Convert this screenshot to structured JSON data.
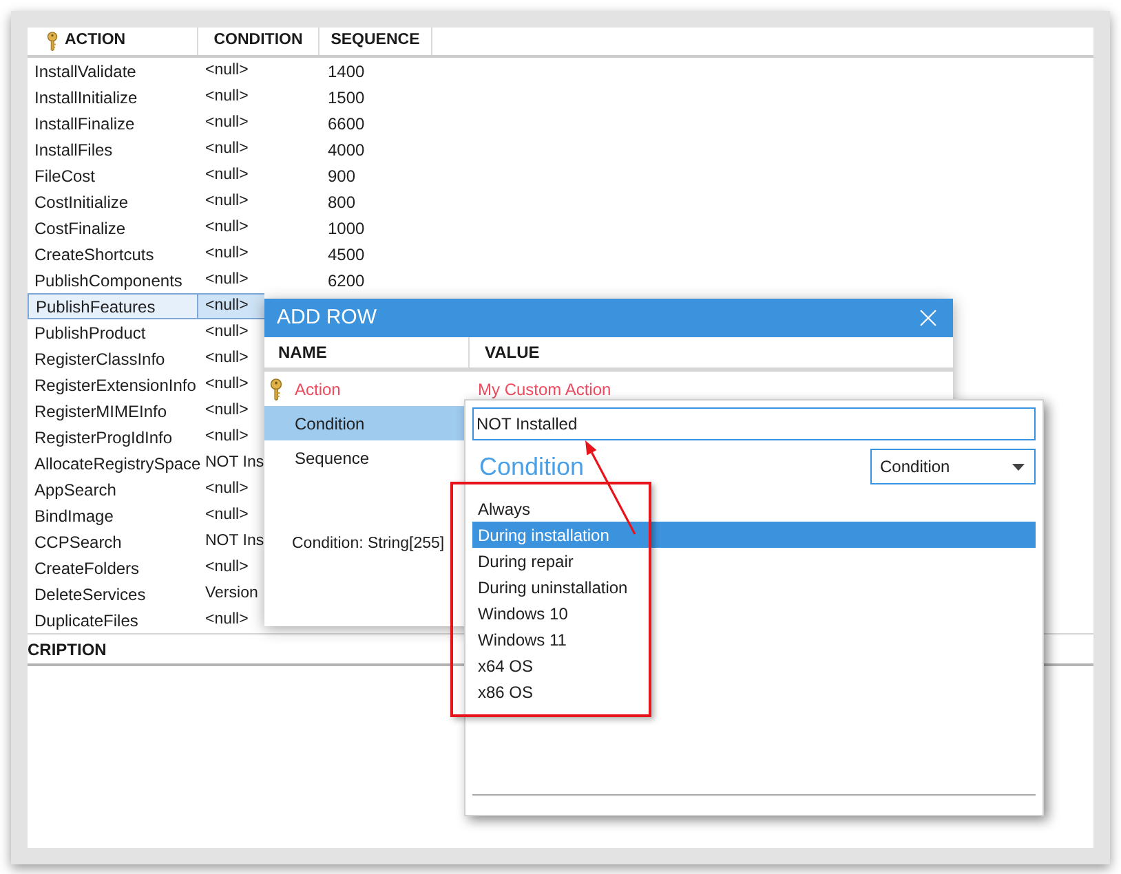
{
  "table": {
    "columns": [
      {
        "label": "ACTION",
        "primary_key": true
      },
      {
        "label": "CONDITION",
        "primary_key": false
      },
      {
        "label": "SEQUENCE",
        "primary_key": false
      }
    ],
    "rows": [
      {
        "action": "InstallValidate",
        "condition": "<null>",
        "sequence": "1400",
        "selected": false
      },
      {
        "action": "InstallInitialize",
        "condition": "<null>",
        "sequence": "1500",
        "selected": false
      },
      {
        "action": "InstallFinalize",
        "condition": "<null>",
        "sequence": "6600",
        "selected": false
      },
      {
        "action": "InstallFiles",
        "condition": "<null>",
        "sequence": "4000",
        "selected": false
      },
      {
        "action": "FileCost",
        "condition": "<null>",
        "sequence": "900",
        "selected": false
      },
      {
        "action": "CostInitialize",
        "condition": "<null>",
        "sequence": "800",
        "selected": false
      },
      {
        "action": "CostFinalize",
        "condition": "<null>",
        "sequence": "1000",
        "selected": false
      },
      {
        "action": "CreateShortcuts",
        "condition": "<null>",
        "sequence": "4500",
        "selected": false
      },
      {
        "action": "PublishComponents",
        "condition": "<null>",
        "sequence": "6200",
        "selected": false
      },
      {
        "action": "PublishFeatures",
        "condition": "<null>",
        "selected": true
      },
      {
        "action": "PublishProduct",
        "condition": "<null>",
        "selected": false
      },
      {
        "action": "RegisterClassInfo",
        "condition": "<null>",
        "selected": false
      },
      {
        "action": "RegisterExtensionInfo",
        "condition": "<null>",
        "selected": false
      },
      {
        "action": "RegisterMIMEInfo",
        "condition": "<null>",
        "selected": false
      },
      {
        "action": "RegisterProgIdInfo",
        "condition": "<null>",
        "selected": false
      },
      {
        "action": "AllocateRegistrySpace",
        "condition": "NOT Ins",
        "selected": false
      },
      {
        "action": "AppSearch",
        "condition": "<null>",
        "selected": false
      },
      {
        "action": "BindImage",
        "condition": "<null>",
        "selected": false
      },
      {
        "action": "CCPSearch",
        "condition": "NOT Ins",
        "selected": false
      },
      {
        "action": "CreateFolders",
        "condition": "<null>",
        "selected": false
      },
      {
        "action": "DeleteServices",
        "condition": "Version",
        "selected": false
      },
      {
        "action": "DuplicateFiles",
        "condition": "<null>",
        "selected": false
      }
    ]
  },
  "description_panel": {
    "heading": "CRIPTION"
  },
  "add_row_dialog": {
    "title": "ADD ROW",
    "columns": [
      "NAME",
      "VALUE"
    ],
    "fields": [
      {
        "name": "Action",
        "value": "My Custom Action",
        "primary_key": true,
        "selected": false
      },
      {
        "name": "Condition",
        "primary_key": false,
        "selected": true
      },
      {
        "name": "Sequence",
        "primary_key": false,
        "selected": false
      }
    ],
    "field_info": "Condition: String[255]"
  },
  "condition_editor": {
    "value": "NOT Installed",
    "heading": "Condition",
    "dropdown": "Condition",
    "options": [
      {
        "label": "Always",
        "selected": false
      },
      {
        "label": "During installation",
        "selected": true
      },
      {
        "label": "During repair",
        "selected": false
      },
      {
        "label": "During uninstallation",
        "selected": false
      },
      {
        "label": "Windows 10",
        "selected": false
      },
      {
        "label": "Windows 11",
        "selected": false
      },
      {
        "label": "x64 OS",
        "selected": false
      },
      {
        "label": "x86 OS",
        "selected": false
      }
    ]
  }
}
